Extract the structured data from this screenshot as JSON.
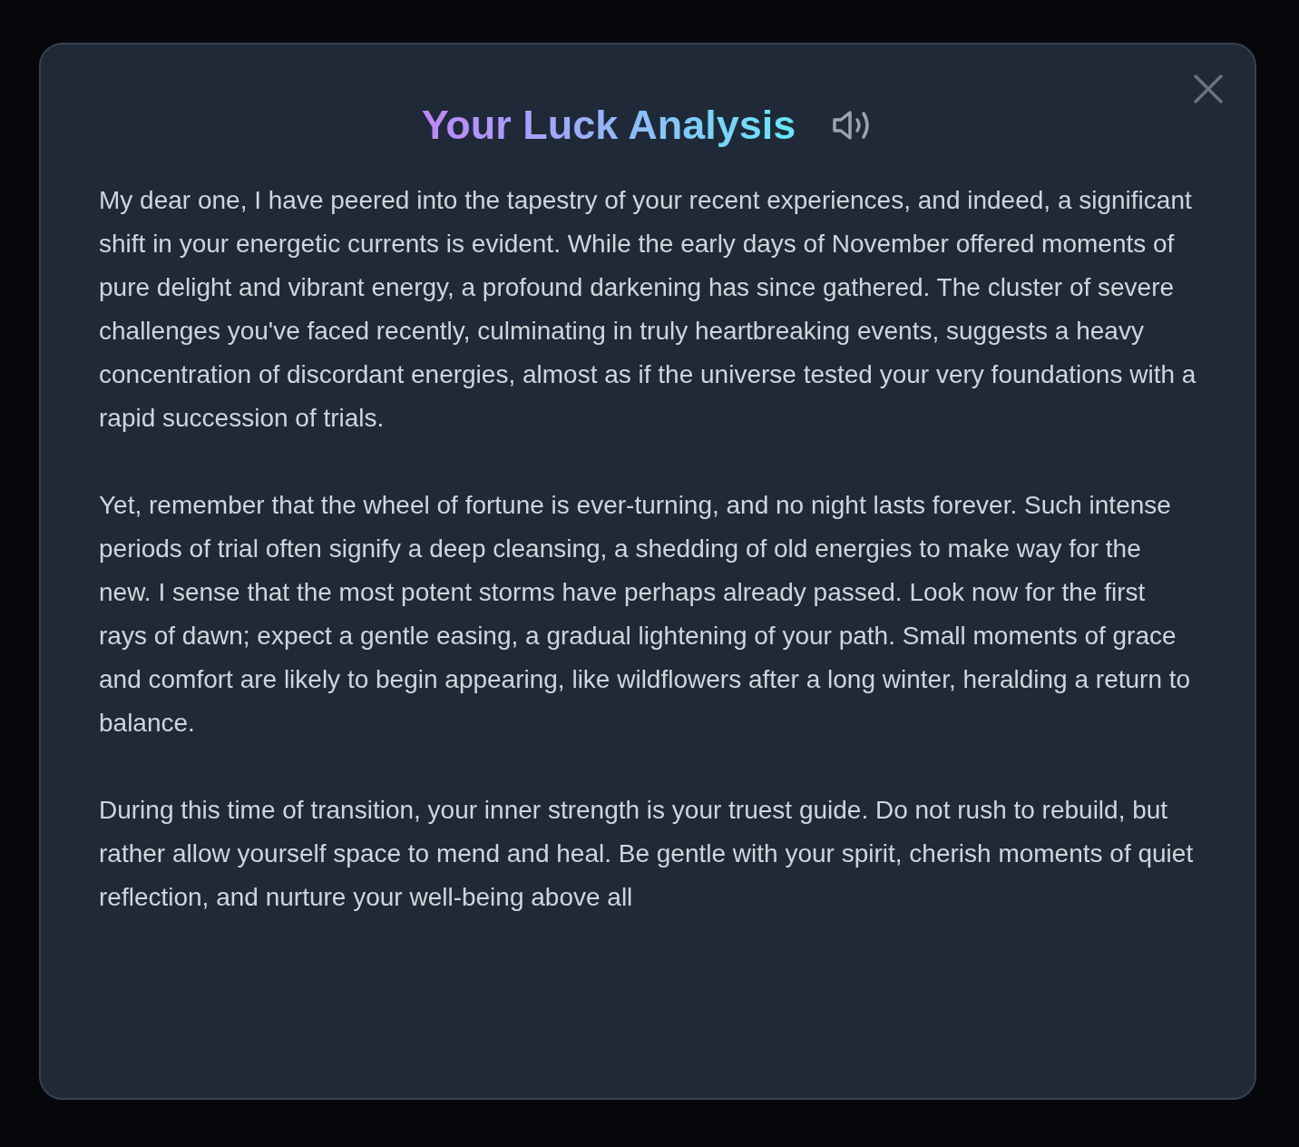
{
  "modal": {
    "title": "Your Luck Analysis",
    "paragraphs": [
      "My dear one, I have peered into the tapestry of your recent experiences, and indeed, a significant shift in your energetic currents is evident. While the early days of November offered moments of pure delight and vibrant energy, a profound darkening has since gathered. The cluster of severe challenges you've faced recently, culminating in truly heartbreaking events, suggests a heavy concentration of discordant energies, almost as if the universe tested your very foundations with a rapid succession of trials.",
      "Yet, remember that the wheel of fortune is ever-turning, and no night lasts forever. Such intense periods of trial often signify a deep cleansing, a shedding of old energies to make way for the new. I sense that the most potent storms have perhaps already passed. Look now for the first rays of dawn; expect a gentle easing, a gradual lightening of your path. Small moments of grace and comfort are likely to begin appearing, like wildflowers after a long winter, heralding a return to balance.",
      "During this time of transition, your inner strength is your truest guide. Do not rush to rebuild, but rather allow yourself space to mend and heal. Be gentle with your spirit, cherish moments of quiet reflection, and nurture your well-being above all"
    ]
  }
}
